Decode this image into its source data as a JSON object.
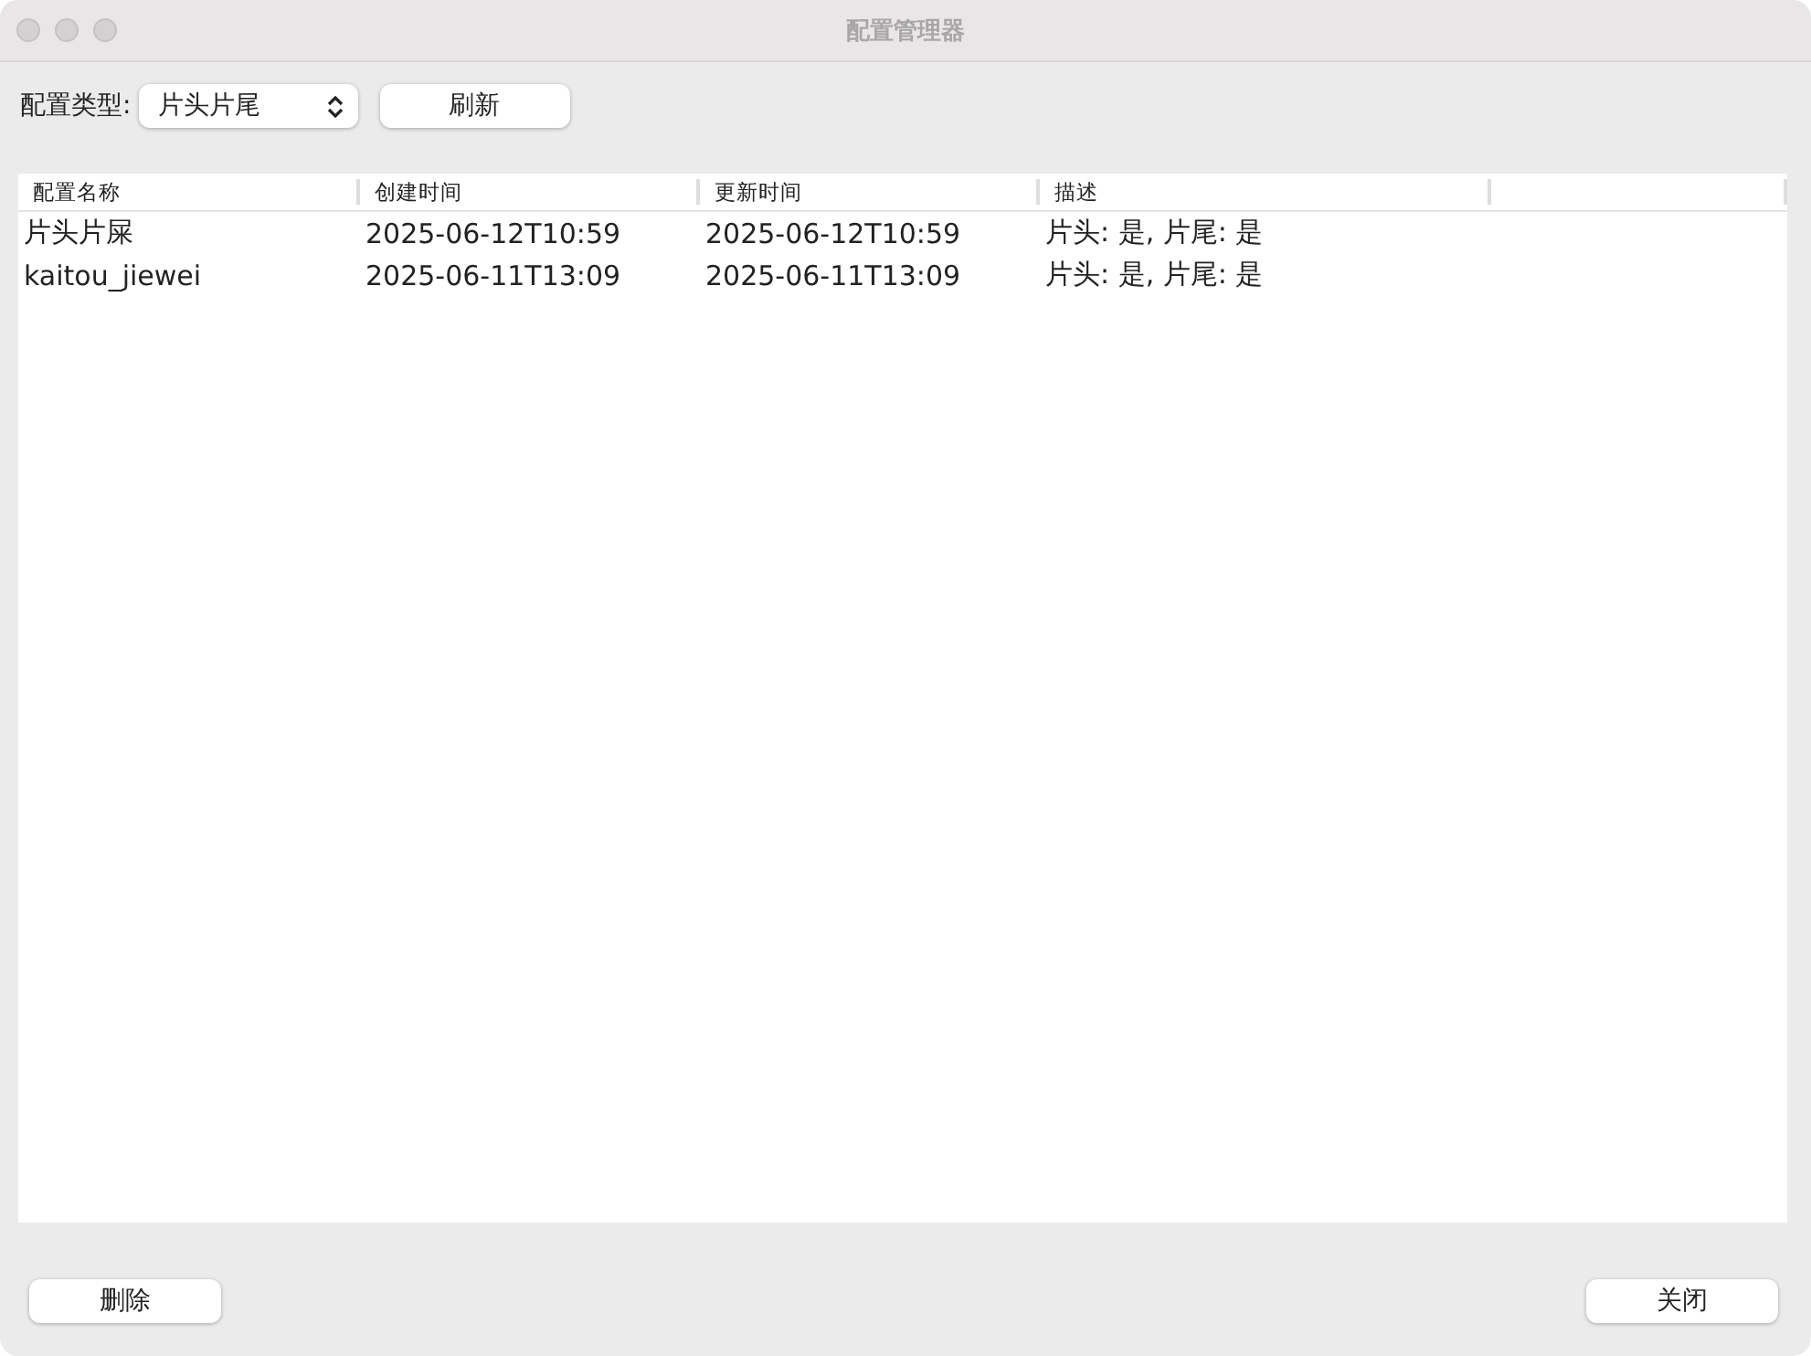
{
  "window": {
    "title": "配置管理器"
  },
  "toolbar": {
    "type_label": "配置类型:",
    "type_select": {
      "value": "片头片尾"
    },
    "refresh_button": "刷新"
  },
  "table": {
    "columns": [
      "配置名称",
      "创建时间",
      "更新时间",
      "描述"
    ],
    "rows": [
      [
        "片头片屎",
        "2025-06-12T10:59",
        "2025-06-12T10:59",
        "片头: 是, 片尾: 是"
      ],
      [
        "kaitou_jiewei",
        "2025-06-11T13:09",
        "2025-06-11T13:09",
        "片头: 是, 片尾: 是"
      ]
    ]
  },
  "buttons": {
    "delete": "删除",
    "close": "关闭"
  }
}
